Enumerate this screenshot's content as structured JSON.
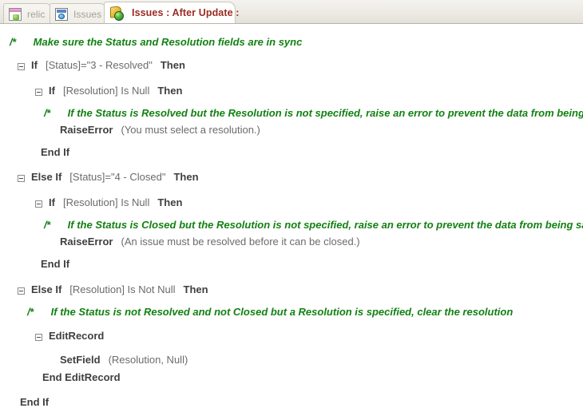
{
  "window": {
    "title": "Issues : After Update :"
  },
  "tabs": [
    {
      "label": "relic",
      "icon": "form-icon",
      "active": false
    },
    {
      "label": "Issues",
      "icon": "table-icon",
      "active": false
    },
    {
      "label": "Issues : After Update :",
      "icon": "macro-icon",
      "active": true
    }
  ],
  "colors": {
    "comment": "#128112",
    "active_tab_text": "#9c2b23",
    "keyword": "#3f3f3f",
    "argument": "#6b6b6b"
  },
  "macro": {
    "lines": [
      {
        "type": "comment",
        "marker": "/*",
        "text": "Make sure the Status and Resolution fields are in sync"
      },
      {
        "type": "block",
        "keyword": "If",
        "condition": "[Status]=\"3 - Resolved\"",
        "terminator": "Then"
      },
      {
        "type": "block",
        "keyword": "If",
        "condition": "[Resolution] Is Null",
        "terminator": "Then"
      },
      {
        "type": "comment",
        "marker": "/*",
        "text": "If the Status is Resolved but the Resolution is not specified, raise an error to prevent the data from being saved"
      },
      {
        "type": "action",
        "name": "RaiseError",
        "args": "(You must select a resolution.)"
      },
      {
        "type": "end",
        "keyword": "End If"
      },
      {
        "type": "block",
        "keyword": "Else If",
        "condition": "[Status]=\"4 - Closed\"",
        "terminator": "Then"
      },
      {
        "type": "block",
        "keyword": "If",
        "condition": "[Resolution] Is Null",
        "terminator": "Then"
      },
      {
        "type": "comment",
        "marker": "/*",
        "text": "If the Status is Closed but the Resolution is not specified, raise an error to prevent the data from being saved"
      },
      {
        "type": "action",
        "name": "RaiseError",
        "args": "(An issue must be resolved before it can be closed.)"
      },
      {
        "type": "end",
        "keyword": "End If"
      },
      {
        "type": "block",
        "keyword": "Else If",
        "condition": "[Resolution] Is Not Null",
        "terminator": "Then"
      },
      {
        "type": "comment",
        "marker": "/*",
        "text": "If the Status is not Resolved and not Closed but a Resolution is specified, clear the resolution"
      },
      {
        "type": "block",
        "keyword": "EditRecord",
        "condition": "",
        "terminator": ""
      },
      {
        "type": "action",
        "name": "SetField",
        "args": "(Resolution, Null)"
      },
      {
        "type": "end",
        "keyword": "End EditRecord"
      },
      {
        "type": "end",
        "keyword": "End If"
      }
    ]
  },
  "text": {
    "l0_marker": "/*",
    "l0_text": "Make sure the Status and Resolution fields are in sync",
    "l1_kw": "If",
    "l1_cond": "[Status]=\"3 - Resolved\"",
    "l1_then": "Then",
    "l2_kw": "If",
    "l2_cond": "[Resolution] Is Null",
    "l2_then": "Then",
    "l3_marker": "/*",
    "l3_text": "If the Status is Resolved but the Resolution is not specified, raise an error to prevent the data from being saved",
    "l4_name": "RaiseError",
    "l4_args": "(You must select a resolution.)",
    "l5_kw": "End If",
    "l6_kw": "Else If",
    "l6_cond": "[Status]=\"4 - Closed\"",
    "l6_then": "Then",
    "l7_kw": "If",
    "l7_cond": "[Resolution] Is Null",
    "l7_then": "Then",
    "l8_marker": "/*",
    "l8_text": "If the Status is Closed but the Resolution is not specified, raise an error to prevent the data from being saved",
    "l9_name": "RaiseError",
    "l9_args": "(An issue must be resolved before it can be closed.)",
    "l10_kw": "End If",
    "l11_kw": "Else If",
    "l11_cond": "[Resolution] Is Not Null",
    "l11_then": "Then",
    "l12_marker": "/*",
    "l12_text": "If the Status is not Resolved and not Closed but a Resolution is specified, clear the resolution",
    "l13_kw": "EditRecord",
    "l14_name": "SetField",
    "l14_args": "(Resolution, Null)",
    "l15_kw": "End EditRecord",
    "l16_kw": "End If"
  }
}
